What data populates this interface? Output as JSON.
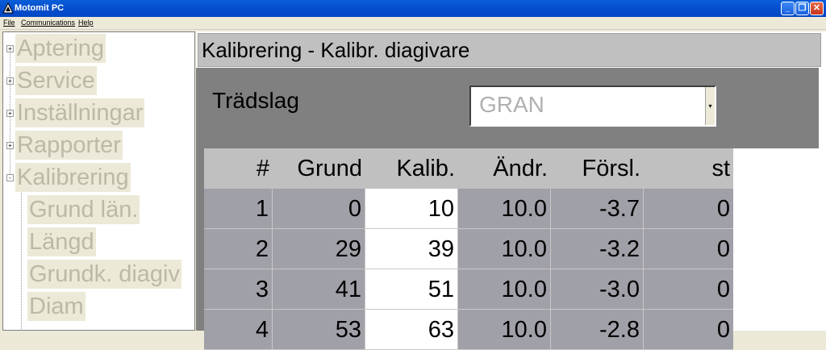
{
  "window": {
    "title": "Motomit PC",
    "icon": "app-logo-icon",
    "controls": [
      "minimize-icon",
      "restore-icon",
      "close-icon"
    ]
  },
  "menu": {
    "file": "File",
    "communications": "Communications",
    "help": "Help"
  },
  "tree": {
    "items": [
      {
        "label": "Aptering",
        "expander": "+"
      },
      {
        "label": "Service",
        "expander": "+"
      },
      {
        "label": "Inställningar",
        "expander": "+"
      },
      {
        "label": "Rapporter",
        "expander": "+"
      },
      {
        "label": "Kalibrering",
        "expander": "-"
      },
      {
        "label": "Grund län."
      },
      {
        "label": "Längd"
      },
      {
        "label": "Grundk. diagiv"
      },
      {
        "label": "Diam"
      }
    ]
  },
  "content": {
    "header_title": "Kalibrering - Kalibr. diagivare",
    "tradslag_label": "Trädslag",
    "tradslag_value": "GRAN"
  },
  "table": {
    "columns": [
      "#",
      "Grund",
      "Kalib.",
      "Ändr.",
      "Försl.",
      "st"
    ],
    "rows": [
      [
        "1",
        "0",
        "10",
        "10.0",
        "-3.7",
        "0"
      ],
      [
        "2",
        "29",
        "39",
        "10.0",
        "-3.2",
        "0"
      ],
      [
        "3",
        "41",
        "51",
        "10.0",
        "-3.0",
        "0"
      ],
      [
        "4",
        "53",
        "63",
        "10.0",
        "-2.8",
        "0"
      ]
    ]
  },
  "colors": {
    "titlebar": "#0550d0",
    "tree_label_bg": "#ece9d8",
    "tree_label_text": "#bdb9a8",
    "band_gray": "#808080",
    "cell_gray": "#a0a0a8"
  }
}
